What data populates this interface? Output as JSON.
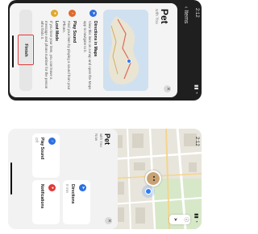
{
  "panel_a": {
    "status_time": "2:12",
    "back_label": "Items",
    "title": "Pet",
    "subtitle": "with You",
    "close_glyph": "✕",
    "tips": [
      {
        "icon": "map-icon",
        "color": "#2d6fe0",
        "title": "Directions in Maps",
        "body": "View this item on a map and open the Maps app to navigate to it."
      },
      {
        "icon": "speaker-icon",
        "color": "#e0682d",
        "title": "Play Sound",
        "body": "Find your item by playing a sound from your iPhone."
      },
      {
        "icon": "lock-icon",
        "color": "#e0a82d",
        "title": "Lost Mode",
        "body": "If you lose your item, you can leave a message and phone number for the person who finds it."
      }
    ],
    "finish_label": "Finish",
    "highlight_color": "#e03a3a"
  },
  "panel_b": {
    "status_time": "2:12",
    "map_controls": [
      "ⓘ",
      "➤"
    ],
    "title": "Pet",
    "subtitle_1": "with You",
    "subtitle_2": "Now",
    "close_glyph": "✕",
    "tiles": [
      {
        "name": "directions",
        "icon": "car-icon",
        "color": "#2d6fe0",
        "label": "Directions",
        "value": "0 min"
      },
      {
        "name": "play-sound",
        "icon": "speaker-icon",
        "color": "#2d6fe0",
        "label": "Play Sound",
        "value": "Off"
      },
      {
        "name": "notifications",
        "icon": "bell-icon",
        "color": "#e03a3a",
        "label": "Notifications",
        "value": ""
      }
    ]
  }
}
